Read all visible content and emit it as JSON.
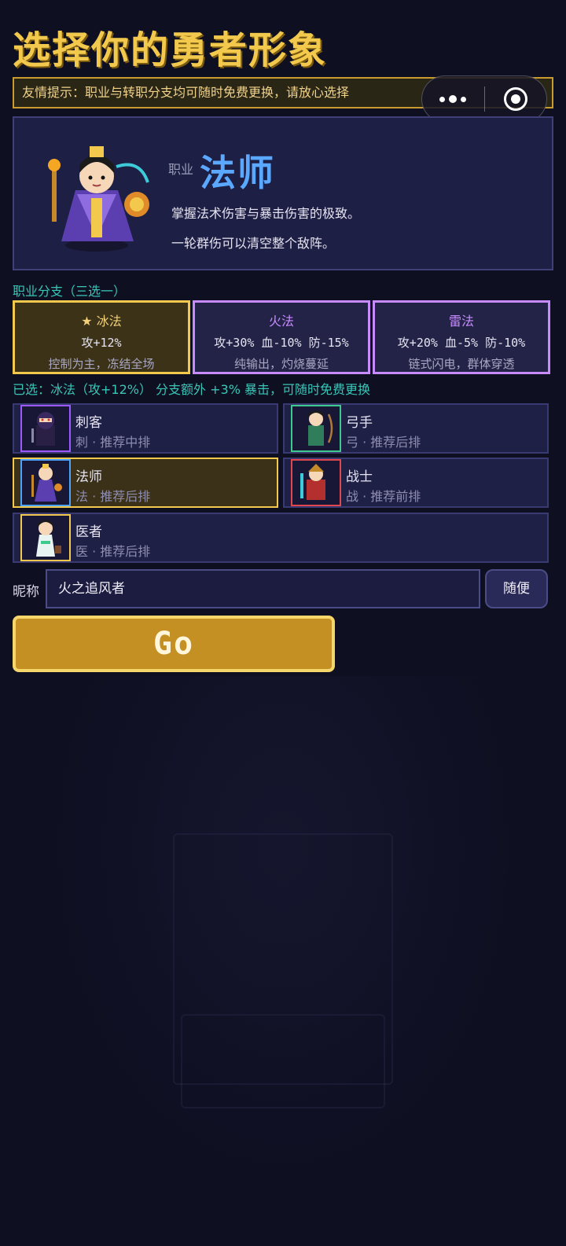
{
  "title": "选择你的勇者形象",
  "tip": "友情提示：职业与转职分支均可随时免费更换，请放心选择",
  "capsule": {
    "more_icon": "more-dots-icon",
    "close_icon": "target-circle-icon"
  },
  "hero": {
    "job_label": "职业",
    "job_name": "法师",
    "desc1": "掌握法术伤害与暴击伤害的极致。",
    "desc2": "一轮群伤可以清空整个敌阵。"
  },
  "branch_label": "职业分支（三选一）",
  "branches": [
    {
      "name": "★ 冰法",
      "stat": "攻+12%",
      "desc": "控制为主，冻结全场",
      "selected": true
    },
    {
      "name": "火法",
      "stat": "攻+30% 血-10% 防-15%",
      "desc": "纯输出，灼烧蔓延",
      "selected": false
    },
    {
      "name": "雷法",
      "stat": "攻+20% 血-5% 防-10%",
      "desc": "链式闪电，群体穿透",
      "selected": false
    }
  ],
  "selected_line": "已选：冰法（攻+12%）  分支额外 +3% 暴击，可随时免费更换",
  "jobs": [
    {
      "name": "刺客",
      "meta": "刺 · 推荐中排",
      "color": "#9b59ff",
      "selected": false
    },
    {
      "name": "弓手",
      "meta": "弓 · 推荐后排",
      "color": "#3ec98f",
      "selected": false
    },
    {
      "name": "法师",
      "meta": "法 · 推荐后排",
      "color": "#4aa3ff",
      "selected": true
    },
    {
      "name": "战士",
      "meta": "战 · 推荐前排",
      "color": "#e0474c",
      "selected": false
    },
    {
      "name": "医者",
      "meta": "医 · 推荐后排",
      "color": "#f2c94c",
      "selected": false
    }
  ],
  "nickname": {
    "label": "昵称",
    "value": "火之追风者",
    "random_label": "随便"
  },
  "go_label": "Go",
  "colors": {
    "accent": "#f2c94c",
    "teal": "#38c6b6",
    "background": "#0f0f22"
  }
}
